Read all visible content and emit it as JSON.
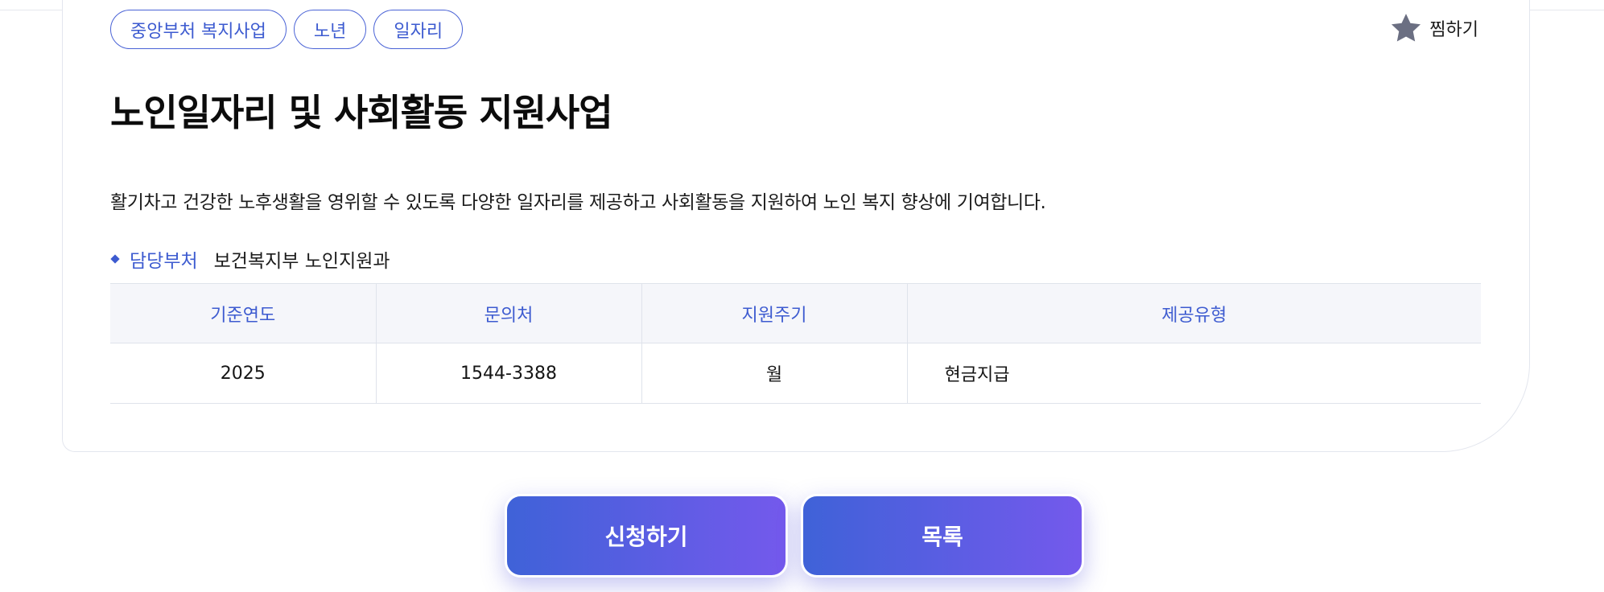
{
  "tags": [
    "중앙부처 복지사업",
    "노년",
    "일자리"
  ],
  "favorite": {
    "label": "찜하기"
  },
  "program": {
    "title": "노인일자리 및 사회활동 지원사업",
    "description": "활기차고 건강한 노후생활을 영위할 수 있도록 다양한 일자리를 제공하고 사회활동을 지원하여 노인 복지 향상에 기여합니다.",
    "department_label": "담당부처",
    "department_value": "보건복지부 노인지원과"
  },
  "info_table": {
    "headers": [
      "기준연도",
      "문의처",
      "지원주기",
      "제공유형"
    ],
    "rows": [
      [
        "2025",
        "1544-3388",
        "월",
        "현금지급"
      ]
    ]
  },
  "actions": {
    "apply_label": "신청하기",
    "list_label": "목록"
  },
  "colors": {
    "accent": "#3d5bd0",
    "gradient_start": "#3f62d8",
    "gradient_end": "#7459ec",
    "star": "#6b6f82"
  },
  "icons": {
    "favorite": "star-icon",
    "bullet": "diamond-bullet-icon"
  }
}
